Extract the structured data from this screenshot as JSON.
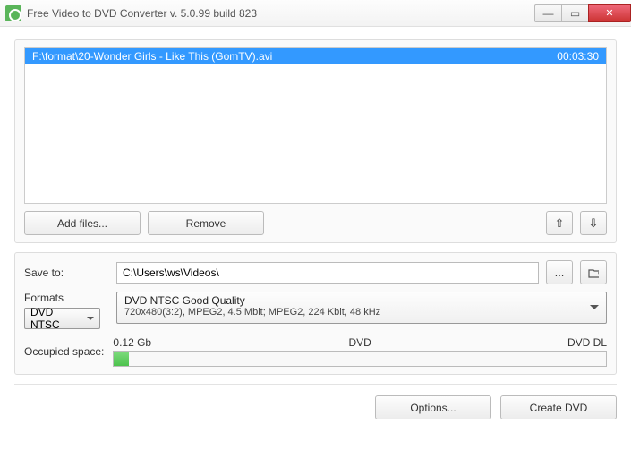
{
  "window": {
    "title": "Free Video to DVD Converter  v. 5.0.99 build 823"
  },
  "file_list": {
    "items": [
      {
        "path": "F:\\format\\20-Wonder Girls - Like This (GomTV).avi",
        "duration": "00:03:30"
      }
    ]
  },
  "buttons": {
    "add_files": "Add files...",
    "remove": "Remove",
    "move_up": "⇧",
    "move_down": "⇩",
    "browse": "...",
    "open_folder": "⮱",
    "options": "Options...",
    "create_dvd": "Create DVD"
  },
  "save": {
    "label": "Save to:",
    "path": "C:\\Users\\ws\\Videos\\"
  },
  "formats": {
    "label": "Formats",
    "selected": "DVD NTSC",
    "quality_title": "DVD NTSC Good Quality",
    "quality_detail": "720x480(3:2), MPEG2, 4.5 Mbit; MPEG2, 224 Kbit, 48 kHz"
  },
  "occupied": {
    "label": "Occupied space:",
    "value": "0.12 Gb",
    "mid_label": "DVD",
    "end_label": "DVD DL",
    "percent": 3
  }
}
